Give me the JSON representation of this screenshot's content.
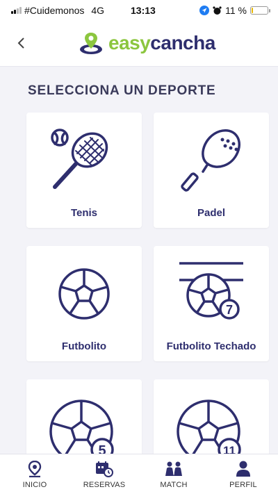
{
  "status": {
    "carrier": "#Cuidemonos",
    "network": "4G",
    "time": "13:13",
    "battery": "11 %",
    "battery_level": 0.11
  },
  "header": {
    "logo_easy": "easy",
    "logo_cancha": "cancha"
  },
  "title": "SELECCIONA UN DEPORTE",
  "sports": [
    {
      "label": "Tenis",
      "icon": "tennis-racket-icon"
    },
    {
      "label": "Padel",
      "icon": "padel-racket-icon"
    },
    {
      "label": "Futbolito",
      "icon": "soccer-ball-icon"
    },
    {
      "label": "Futbolito Techado",
      "icon": "indoor-soccer-7-icon",
      "badge": "7"
    },
    {
      "label": "",
      "icon": "soccer-ball-5-icon",
      "badge": "5"
    },
    {
      "label": "",
      "icon": "soccer-ball-11-icon",
      "badge": "11"
    }
  ],
  "nav": [
    {
      "label": "INICIO",
      "icon": "location-pin-icon"
    },
    {
      "label": "RESERVAS",
      "icon": "calendar-clock-icon"
    },
    {
      "label": "MATCH",
      "icon": "people-icon"
    },
    {
      "label": "PERFIL",
      "icon": "user-icon"
    }
  ],
  "colors": {
    "brand_navy": "#2e2e6e",
    "brand_green": "#8cc63f",
    "background": "#f3f3f8"
  }
}
